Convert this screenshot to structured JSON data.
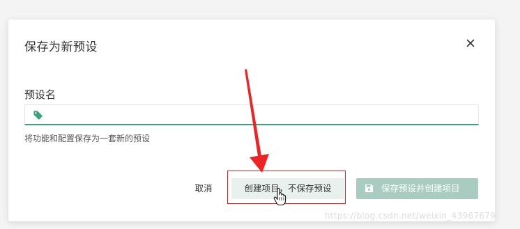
{
  "dialog": {
    "title": "保存为新预设",
    "close_label": "×"
  },
  "form": {
    "label": "预设名",
    "input_value": "",
    "input_placeholder": "",
    "help_text": "将功能和配置保存为一套新的预设"
  },
  "footer": {
    "cancel_label": "取消",
    "create_label": "创建项目，不保存预设",
    "save_create_label": "保存预设并创建项目"
  },
  "watermark": "https://blog.csdn.net/weixin_43967679",
  "colors": {
    "accent": "#3aa17e",
    "disabled_button": "#a8ccbf",
    "secondary_button": "#e8f1ed",
    "highlight": "#e02020"
  },
  "icons": {
    "close": "close-icon",
    "tag": "tag-icon",
    "save": "save-icon",
    "cursor": "hand-cursor-icon",
    "arrow": "red-arrow-annotation"
  }
}
